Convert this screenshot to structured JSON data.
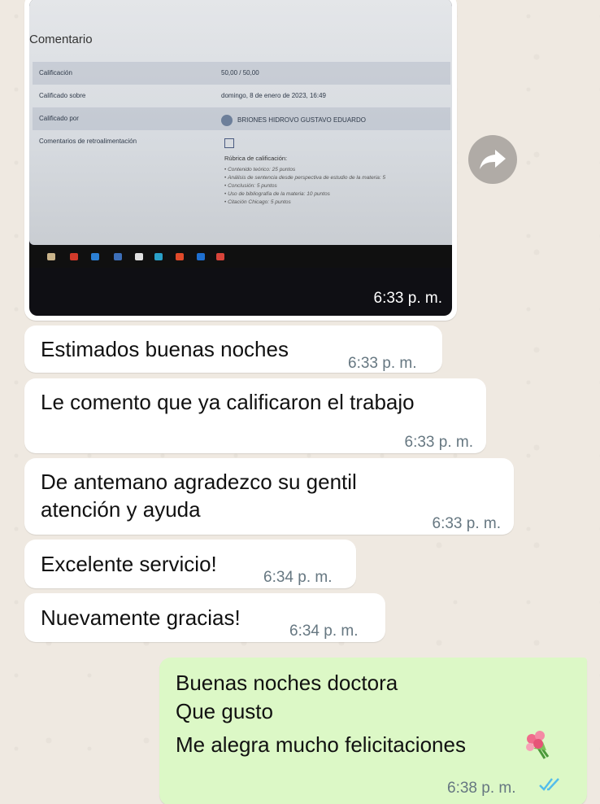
{
  "image_message": {
    "comment_header": "Comentario",
    "rows": [
      {
        "label": "Calificación",
        "value": "50,00 / 50,00"
      },
      {
        "label": "Calificado sobre",
        "value": "domingo, 8 de enero de 2023, 16:49"
      },
      {
        "label": "Calificado por",
        "value": "BRIONES HIDROVO GUSTAVO EDUARDO"
      }
    ],
    "feedback_label": "Comentarios de retroalimentación",
    "rubric_title": "Rúbrica de calificación:",
    "rubric_items": [
      "Contenido teórico: 25 puntos",
      "Análisis de sentencia desde perspectiva de estudio de la materia: 5",
      "Conclusión: 5 puntos",
      "Uso de bibliografía de la materia: 10 puntos",
      "Citación Chicago: 5 puntos"
    ],
    "time": "6:33 p. m."
  },
  "forward_icon": "forward-arrow-icon",
  "messages": [
    {
      "text": "Estimados buenas noches",
      "time": "6:33 p. m."
    },
    {
      "text": "Le comento que ya calificaron el trabajo",
      "time": "6:33 p. m."
    },
    {
      "text_line1": "De antemano agradezco su gentil",
      "text_line2": "atención y ayuda",
      "time": "6:33 p. m."
    },
    {
      "text": "Excelente servicio!",
      "time": "6:34 p. m."
    },
    {
      "text": "Nuevamente gracias!",
      "time": "6:34 p. m."
    }
  ],
  "outgoing": {
    "line1": "Buenas noches doctora",
    "line2": "Que gusto",
    "line3": "Me alegra mucho felicitaciones",
    "emoji": "💐",
    "time": "6:38 p. m.",
    "status_icon": "double-check-read-icon"
  },
  "colors": {
    "outgoing_bubble": "#dcf8c6",
    "incoming_bubble": "#ffffff",
    "timestamp": "#667781",
    "read_ticks": "#53bdeb"
  }
}
